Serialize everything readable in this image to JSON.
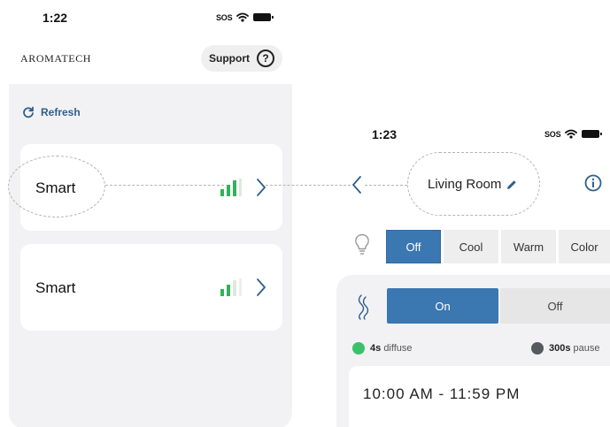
{
  "left_screen": {
    "status": {
      "time": "1:22",
      "sos": "SOS"
    },
    "brand": "AROMATECH",
    "support": {
      "label": "Support",
      "icon": "help-icon"
    },
    "refresh": {
      "label": "Refresh",
      "icon": "refresh-icon"
    },
    "devices": [
      {
        "name": "Smart",
        "signal_bars": 3,
        "icon": "signal-icon"
      },
      {
        "name": "Smart",
        "signal_bars": 2,
        "icon": "signal-icon"
      }
    ]
  },
  "right_screen": {
    "status": {
      "time": "1:23",
      "sos": "SOS"
    },
    "room_title": "Living Room",
    "light_modes": [
      "Off",
      "Cool",
      "Warm",
      "Color"
    ],
    "light_selected": "Off",
    "diffuser_modes": [
      "On",
      "Off"
    ],
    "diffuser_selected": "On",
    "diffuse": {
      "value": "4s",
      "label": "diffuse",
      "color": "#3cc16b"
    },
    "pause": {
      "value": "300s",
      "label": "pause",
      "color": "#555a60"
    },
    "schedule_time_partial": "10:00 AM - 11:59 PM"
  },
  "colors": {
    "accent_blue": "#3b77b0",
    "signal_green": "#2fb45a",
    "link_blue": "#2e5f8a",
    "panel_bg": "#f2f2f4"
  }
}
